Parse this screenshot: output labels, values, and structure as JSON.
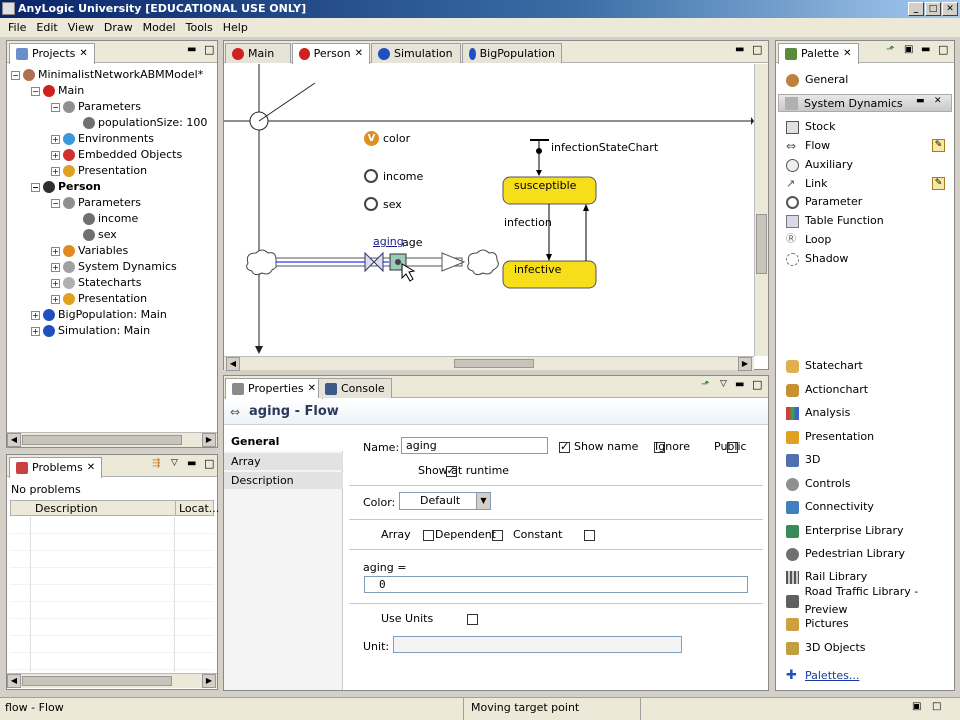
{
  "window": {
    "title": "AnyLogic University [EDUCATIONAL USE ONLY]",
    "btn_min": "_",
    "btn_max": "□",
    "btn_close": "✕"
  },
  "menu": [
    "File",
    "Edit",
    "View",
    "Draw",
    "Model",
    "Tools",
    "Help"
  ],
  "projects": {
    "tab": "Projects",
    "tree": [
      {
        "label": "MinimalistNetworkABMModel*",
        "bold": false
      },
      {
        "label": "Main",
        "bold": false
      },
      {
        "label": "Parameters",
        "bold": false
      },
      {
        "label": "populationSize: 100",
        "bold": false
      },
      {
        "label": "Environments",
        "bold": false
      },
      {
        "label": "Embedded Objects",
        "bold": false
      },
      {
        "label": "Presentation",
        "bold": false
      },
      {
        "label": "Person",
        "bold": true
      },
      {
        "label": "Parameters",
        "bold": false
      },
      {
        "label": "income",
        "bold": false
      },
      {
        "label": "sex",
        "bold": false
      },
      {
        "label": "Variables",
        "bold": false
      },
      {
        "label": "System Dynamics",
        "bold": false
      },
      {
        "label": "Statecharts",
        "bold": false
      },
      {
        "label": "Presentation",
        "bold": false
      },
      {
        "label": "BigPopulation: Main",
        "bold": false
      },
      {
        "label": "Simulation: Main",
        "bold": false
      }
    ]
  },
  "problems": {
    "tab": "Problems",
    "message": "No problems",
    "col_description": "Description",
    "col_location": "Locat..."
  },
  "editor": {
    "tabs": [
      "Main",
      "Person",
      "Simulation",
      "BigPopulation"
    ],
    "canvas": {
      "color_label": "color",
      "color_badge": "V",
      "income_label": "income",
      "sex_label": "sex",
      "flow_label": "aging",
      "stock_label": "age",
      "statechart_label": "infectionStateChart",
      "state_susceptible": "susceptible",
      "state_infective": "infective",
      "transition_label": "infection"
    }
  },
  "properties": {
    "tab_properties": "Properties",
    "tab_console": "Console",
    "heading": "aging - Flow",
    "side_tabs": [
      "General",
      "Array",
      "Description"
    ],
    "name_label": "Name:",
    "name_value": "aging",
    "show_name": "Show name",
    "ignore": "Ignore",
    "public": "Public",
    "show_at_runtime": "Show at runtime",
    "color_label": "Color:",
    "color_value": "Default",
    "array": "Array",
    "dependent": "Dependent",
    "constant": "Constant",
    "formula_label": "aging =",
    "formula_value": "0",
    "use_units": "Use Units",
    "unit_label": "Unit:"
  },
  "palette": {
    "tab": "Palette",
    "general": "General",
    "section_sd": "System Dynamics",
    "sd_items": [
      "Stock",
      "Flow",
      "Auxiliary",
      "Link",
      "Parameter",
      "Table Function",
      "Loop",
      "Shadow"
    ],
    "other_items": [
      "Statechart",
      "Actionchart",
      "Analysis",
      "Presentation",
      "3D",
      "Controls",
      "Connectivity",
      "Enterprise Library",
      "Pedestrian Library",
      "Rail Library",
      "Road Traffic Library - Preview",
      "Pictures",
      "3D Objects"
    ],
    "palettes_link": "Palettes..."
  },
  "status": {
    "left": "flow - Flow",
    "middle": "Moving target point"
  }
}
